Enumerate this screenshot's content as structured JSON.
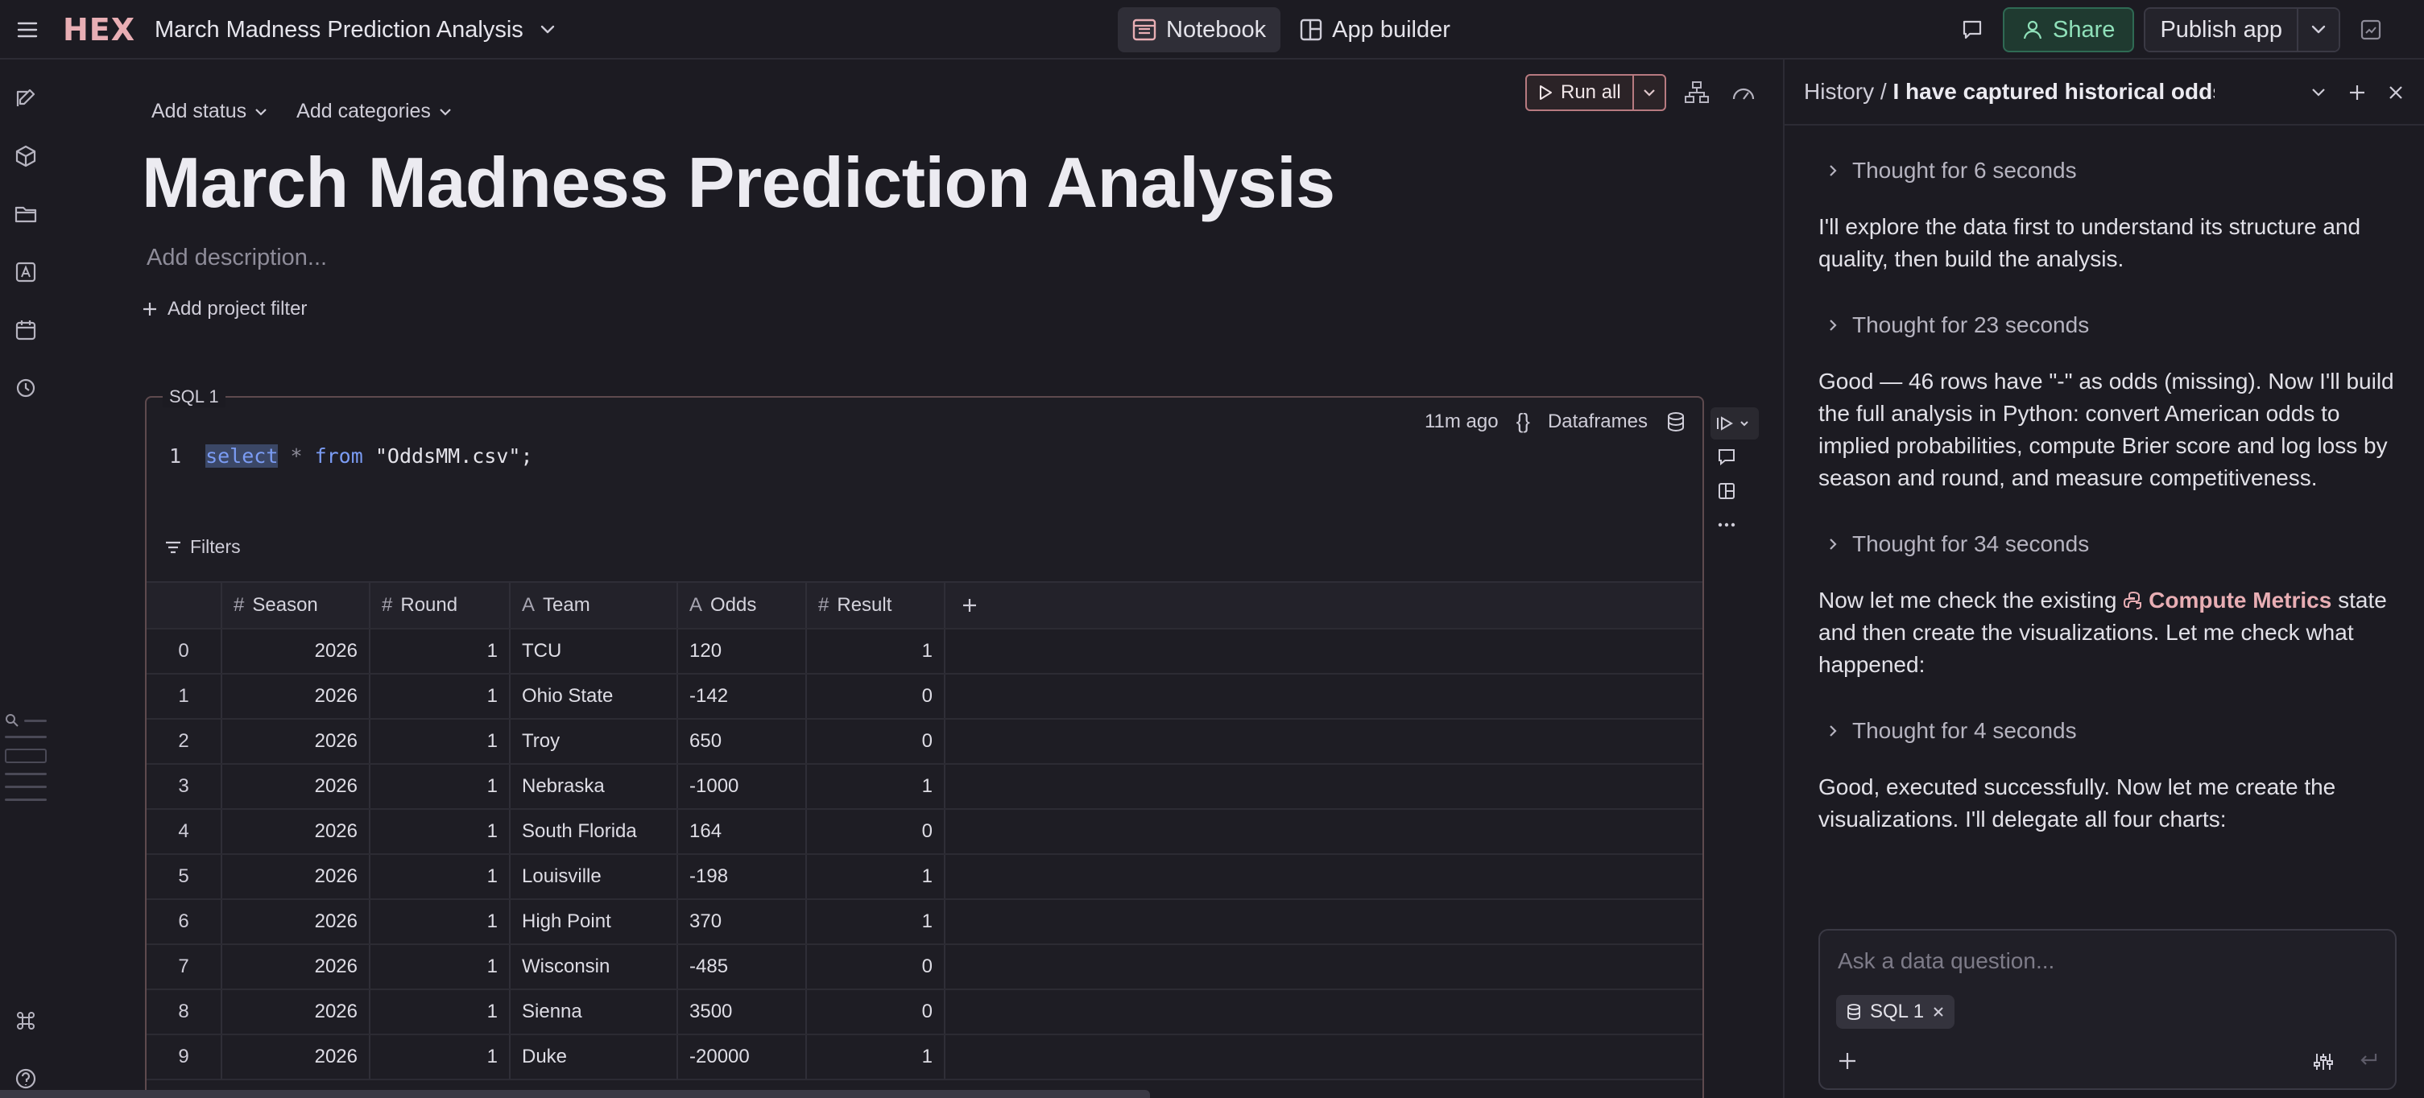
{
  "app": {
    "logo": "HEX",
    "project_title": "March Madness Prediction Analysis"
  },
  "modes": [
    {
      "label": "Notebook",
      "active": true
    },
    {
      "label": "App builder",
      "active": false
    }
  ],
  "actions": {
    "share": "Share",
    "publish": "Publish app"
  },
  "notebook": {
    "add_status": "Add status",
    "add_categories": "Add categories",
    "run_all": "Run all",
    "title": "March Madness Prediction Analysis",
    "description_placeholder": "Add description...",
    "add_filter": "Add project filter"
  },
  "cell": {
    "label": "SQL 1",
    "time_ago": "11m ago",
    "braces": "{}",
    "output_label": "Dataframes",
    "line_number": "1",
    "code": {
      "kw1": "select",
      "star": "*",
      "kw2": "from",
      "table": "\"OddsMM.csv\";"
    },
    "filters_label": "Filters",
    "columns": [
      {
        "name": "Season",
        "type_icon": "#"
      },
      {
        "name": "Round",
        "type_icon": "#"
      },
      {
        "name": "Team",
        "type_icon": "A"
      },
      {
        "name": "Odds",
        "type_icon": "A"
      },
      {
        "name": "Result",
        "type_icon": "#"
      }
    ],
    "rows": [
      {
        "idx": "0",
        "season": "2026",
        "round": "1",
        "team": "TCU",
        "odds": "120",
        "result": "1"
      },
      {
        "idx": "1",
        "season": "2026",
        "round": "1",
        "team": "Ohio State",
        "odds": "-142",
        "result": "0"
      },
      {
        "idx": "2",
        "season": "2026",
        "round": "1",
        "team": "Troy",
        "odds": "650",
        "result": "0"
      },
      {
        "idx": "3",
        "season": "2026",
        "round": "1",
        "team": "Nebraska",
        "odds": "-1000",
        "result": "1"
      },
      {
        "idx": "4",
        "season": "2026",
        "round": "1",
        "team": "South Florida",
        "odds": "164",
        "result": "0"
      },
      {
        "idx": "5",
        "season": "2026",
        "round": "1",
        "team": "Louisville",
        "odds": "-198",
        "result": "1"
      },
      {
        "idx": "6",
        "season": "2026",
        "round": "1",
        "team": "High Point",
        "odds": "370",
        "result": "1"
      },
      {
        "idx": "7",
        "season": "2026",
        "round": "1",
        "team": "Wisconsin",
        "odds": "-485",
        "result": "0"
      },
      {
        "idx": "8",
        "season": "2026",
        "round": "1",
        "team": "Sienna",
        "odds": "3500",
        "result": "0"
      },
      {
        "idx": "9",
        "season": "2026",
        "round": "1",
        "team": "Duke",
        "odds": "-20000",
        "result": "1"
      }
    ]
  },
  "chat": {
    "history_label": "History",
    "separator": "/",
    "thread_title": "I have captured historical odds on N...",
    "messages": {
      "t1": "Thought for 6 seconds",
      "m1": "I'll explore the data first to understand its structure and quality, then build the analysis.",
      "t2": "Thought for 23 seconds",
      "m2": "Good — 46 rows have \"-\" as odds (missing). Now I'll build the full analysis in Python: convert American odds to implied probabilities, compute Brier score and log loss by season and round, and measure competitiveness.",
      "t3": "Thought for 34 seconds",
      "m3_pre": "Now let me check the existing ",
      "m3_ref": "Compute Metrics",
      "m3_post": " state and then create the visualizations. Let me check what happened:",
      "t4": "Thought for 4 seconds",
      "m4": "Good, executed successfully. Now let me create the visualizations. I'll delegate all four charts:"
    },
    "composer_placeholder": "Ask a data question...",
    "composer_chip": "SQL 1"
  },
  "colors": {
    "brand": "#e8aeb4",
    "share_green": "#8fe0b9",
    "keyword_blue": "#7b9cf4",
    "background": "#1c1b22"
  }
}
